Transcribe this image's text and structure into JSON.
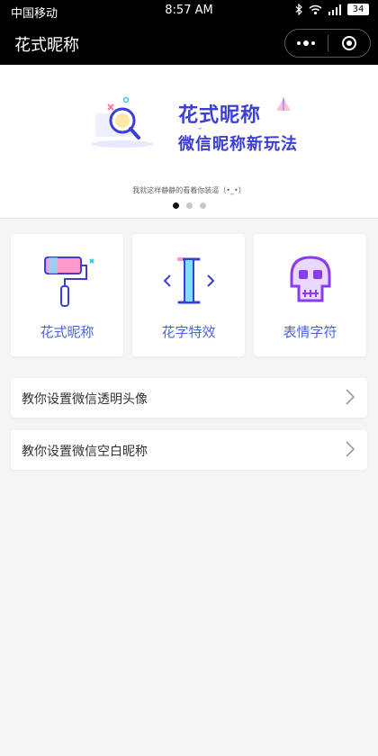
{
  "status_bar": {
    "carrier": "中国移动",
    "time": "8:57 AM",
    "battery": "34",
    "icons": [
      "bluetooth-icon",
      "wifi-icon",
      "signal-icon",
      "battery-icon"
    ]
  },
  "nav": {
    "title": "花式昵称",
    "menu_icon": "more-dots-icon",
    "close_icon": "target-icon"
  },
  "banner": {
    "title": "花式昵称",
    "subtitle": "微信昵称新玩法",
    "caption": "我就这样静静的看着你装逼（•_•）",
    "slides": 3,
    "active_slide": 0
  },
  "cards": [
    {
      "label": "花式昵称",
      "icon": "paint-roller-icon"
    },
    {
      "label": "花字特效",
      "icon": "text-cursor-icon"
    },
    {
      "label": "表情字符",
      "icon": "skull-icon"
    }
  ],
  "list": [
    {
      "label": "教你设置微信透明头像"
    },
    {
      "label": "教你设置微信空白昵称"
    }
  ],
  "colors": {
    "accent": "#4c63e0",
    "banner_title": "#3b3fd6",
    "bar_bg": "#000000",
    "page_bg": "#f5f5f5"
  }
}
